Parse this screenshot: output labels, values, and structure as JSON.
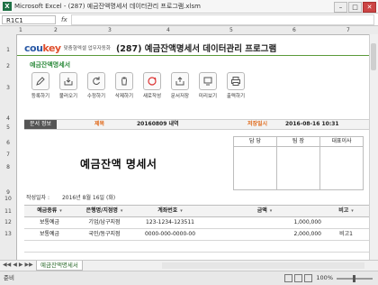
{
  "window": {
    "title": "Microsoft Excel - (287) 예금잔액명세서 데이터관리 프로그램.xlsm",
    "app_icon": "X"
  },
  "formula_bar": {
    "name_box": "R1C1",
    "fx": "fx",
    "value": ""
  },
  "columns": [
    "1",
    "2",
    "3",
    "4",
    "5",
    "6",
    "7"
  ],
  "rows": [
    "1",
    "2",
    "3",
    "4",
    "5",
    "6",
    "7",
    "8",
    "9",
    "10",
    "11",
    "12",
    "13"
  ],
  "header": {
    "logo_main": "cou",
    "logo_accent": "key",
    "logo_sub": "맞춤형엑셀 업무자동화",
    "program_title": "(287) 예금잔액명세서 데이터관리 프로그램"
  },
  "sheet_label": "예금잔액명세서",
  "toolbar": [
    {
      "label": "등록하기",
      "icon": "pencil-icon"
    },
    {
      "label": "불러오기",
      "icon": "inbox-icon"
    },
    {
      "label": "수정하기",
      "icon": "refresh-icon"
    },
    {
      "label": "삭제하기",
      "icon": "trash-icon"
    },
    {
      "label": "새로작성",
      "icon": "new-icon"
    },
    {
      "label": "문서저장",
      "icon": "save-icon"
    },
    {
      "label": "미리보기",
      "icon": "preview-icon"
    },
    {
      "label": "출력하기",
      "icon": "print-icon"
    }
  ],
  "info": {
    "doc_info_label": "문서 정보",
    "subject_label": "제목",
    "subject_value": "20160809 내역",
    "saved_label": "저장일시",
    "saved_value": "2016-08-16 10:31"
  },
  "approval": {
    "cols": [
      "담 당",
      "팀 장",
      "대표이사"
    ]
  },
  "document": {
    "title": "예금잔액 명세서",
    "writer_label": "작성일자 :",
    "writer_date": "2016년 8월 16일 (화)"
  },
  "table": {
    "headers": [
      "예금종류",
      "은행명/지점명",
      "계좌번호",
      "금액",
      "비고"
    ],
    "rows": [
      [
        "보통예금",
        "기업/남구지점",
        "123-1234-123511",
        "1,000,000",
        ""
      ],
      [
        "보통예금",
        "국민/동구지점",
        "0000-000-0000-00",
        "2,000,000",
        "비고1"
      ]
    ]
  },
  "sheet_tabs": {
    "active": "예금잔액명세서",
    "nav": [
      "◀◀",
      "◀",
      "▶",
      "▶▶"
    ]
  },
  "status": {
    "ready": "준비",
    "zoom": "100%"
  }
}
